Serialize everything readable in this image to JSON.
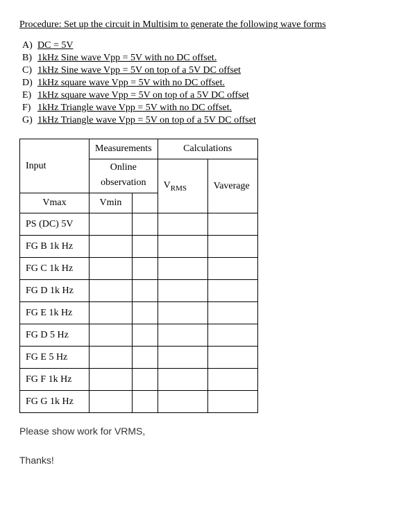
{
  "procedure_title": "Procedure:  Set up the circuit in Multisim to generate the following wave forms",
  "wave_items": [
    {
      "label": "A)",
      "desc": "DC = 5V"
    },
    {
      "label": "B)",
      "desc": "1kHz Sine wave Vpp = 5V with no DC offset."
    },
    {
      "label": "C)",
      "desc": "1kHz Sine wave Vpp = 5V on top of a 5V DC offset"
    },
    {
      "label": "D)",
      "desc": "1kHz square wave Vpp = 5V with no DC offset."
    },
    {
      "label": "E)",
      "desc": "1kHz square wave Vpp = 5V on top of a 5V DC offset"
    },
    {
      "label": "F)",
      "desc": "1kHz Triangle wave Vpp = 5V with no DC offset."
    },
    {
      "label": "G)",
      "desc": "1kHz Triangle wave Vpp = 5V on top of a 5V DC offset"
    }
  ],
  "table": {
    "headers": {
      "measurements": "Measurements",
      "calculations": "Calculations",
      "input": "Input",
      "online": "Online",
      "observation": "observation",
      "vmax": "Vmax",
      "vmin": "Vmin",
      "vrms_prefix": "V",
      "vrms_sub": "RMS",
      "vavg": "Vaverage"
    },
    "rows": [
      {
        "input": "PS (DC) 5V",
        "vmax": "",
        "vmin": "",
        "vrms": "",
        "vavg": ""
      },
      {
        "input": "FG B 1k Hz",
        "vmax": "",
        "vmin": "",
        "vrms": "",
        "vavg": ""
      },
      {
        "input": "FG C 1k Hz",
        "vmax": "",
        "vmin": "",
        "vrms": "",
        "vavg": ""
      },
      {
        "input": "FG D 1k Hz",
        "vmax": "",
        "vmin": "",
        "vrms": "",
        "vavg": ""
      },
      {
        "input": "FG E 1k Hz",
        "vmax": "",
        "vmin": "",
        "vrms": "",
        "vavg": ""
      },
      {
        "input": "FG D 5 Hz",
        "vmax": "",
        "vmin": "",
        "vrms": "",
        "vavg": ""
      },
      {
        "input": "FG E 5 Hz",
        "vmax": "",
        "vmin": "",
        "vrms": "",
        "vavg": ""
      },
      {
        "input": "FG F 1k Hz",
        "vmax": "",
        "vmin": "",
        "vrms": "",
        "vavg": ""
      },
      {
        "input": "FG G 1k Hz",
        "vmax": "",
        "vmin": "",
        "vrms": "",
        "vavg": ""
      }
    ]
  },
  "footer_note": "Please show work for VRMS,",
  "thanks": "Thanks!"
}
